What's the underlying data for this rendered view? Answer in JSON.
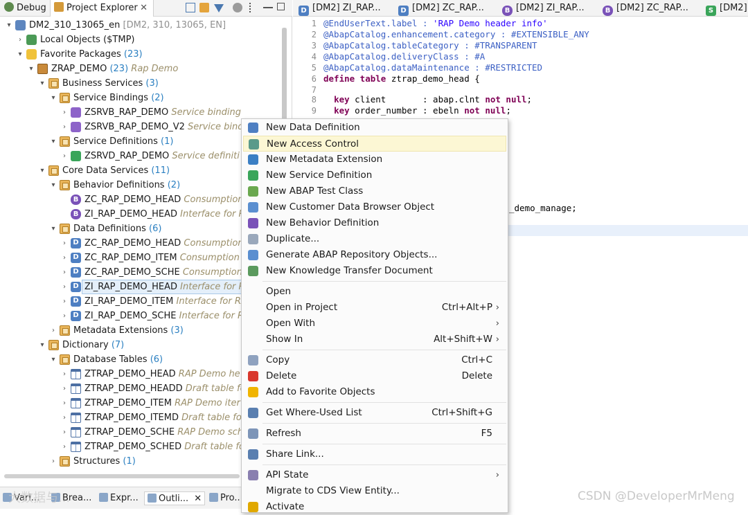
{
  "left_tabs": {
    "debug": "Debug",
    "project_explorer": "Project Explorer",
    "close": "✕"
  },
  "tree": [
    {
      "indent": 0,
      "twisty": "▾",
      "icon": "proj",
      "label": "DM2_310_13065_en",
      "count": "",
      "desc": "[DM2, 310, 13065, EN]",
      "desc_plain": true
    },
    {
      "indent": 1,
      "twisty": "›",
      "icon": "local",
      "label": "Local Objects ($TMP)",
      "count": "",
      "desc": ""
    },
    {
      "indent": 1,
      "twisty": "▾",
      "icon": "fav",
      "label": "Favorite Packages",
      "count": "(23)",
      "desc": ""
    },
    {
      "indent": 2,
      "twisty": "▾",
      "icon": "pkg",
      "label": "ZRAP_DEMO",
      "count": "(23)",
      "desc": "Rap Demo"
    },
    {
      "indent": 3,
      "twisty": "▾",
      "icon": "pkgfolder",
      "label": "Business Services",
      "count": "(3)",
      "desc": ""
    },
    {
      "indent": 4,
      "twisty": "▾",
      "icon": "pkgfolder",
      "label": "Service Bindings",
      "count": "(2)",
      "desc": ""
    },
    {
      "indent": 5,
      "twisty": "›",
      "icon": "bind",
      "label": "ZSRVB_RAP_DEMO",
      "count": "",
      "desc": "Service binding"
    },
    {
      "indent": 5,
      "twisty": "›",
      "icon": "bind",
      "label": "ZSRVB_RAP_DEMO_V2",
      "count": "",
      "desc": "Service bindi"
    },
    {
      "indent": 4,
      "twisty": "▾",
      "icon": "pkgfolder",
      "label": "Service Definitions",
      "count": "(1)",
      "desc": ""
    },
    {
      "indent": 5,
      "twisty": "›",
      "icon": "sd",
      "label": "ZSRVD_RAP_DEMO",
      "count": "",
      "desc": "Service definiti"
    },
    {
      "indent": 3,
      "twisty": "▾",
      "icon": "pkgfolder",
      "label": "Core Data Services",
      "count": "(11)",
      "desc": ""
    },
    {
      "indent": 4,
      "twisty": "▾",
      "icon": "pkgfolder",
      "label": "Behavior Definitions",
      "count": "(2)",
      "desc": ""
    },
    {
      "indent": 5,
      "twisty": "",
      "icon": "b",
      "label": "ZC_RAP_DEMO_HEAD",
      "count": "",
      "desc": "Consumption"
    },
    {
      "indent": 5,
      "twisty": "",
      "icon": "b",
      "label": "ZI_RAP_DEMO_HEAD",
      "count": "",
      "desc": "Interface for R"
    },
    {
      "indent": 4,
      "twisty": "▾",
      "icon": "pkgfolder",
      "label": "Data Definitions",
      "count": "(6)",
      "desc": ""
    },
    {
      "indent": 5,
      "twisty": "›",
      "icon": "d",
      "label": "ZC_RAP_DEMO_HEAD",
      "count": "",
      "desc": "Consumption"
    },
    {
      "indent": 5,
      "twisty": "›",
      "icon": "d",
      "label": "ZC_RAP_DEMO_ITEM",
      "count": "",
      "desc": "Consumption"
    },
    {
      "indent": 5,
      "twisty": "›",
      "icon": "d",
      "label": "ZC_RAP_DEMO_SCHE",
      "count": "",
      "desc": "Consumption"
    },
    {
      "indent": 5,
      "twisty": "›",
      "icon": "d",
      "label": "ZI_RAP_DEMO_HEAD",
      "count": "",
      "desc": "Interface for R",
      "selected": true
    },
    {
      "indent": 5,
      "twisty": "›",
      "icon": "d",
      "label": "ZI_RAP_DEMO_ITEM",
      "count": "",
      "desc": "Interface for RA"
    },
    {
      "indent": 5,
      "twisty": "›",
      "icon": "d",
      "label": "ZI_RAP_DEMO_SCHE",
      "count": "",
      "desc": "Interface for R"
    },
    {
      "indent": 4,
      "twisty": "›",
      "icon": "pkgfolder",
      "label": "Metadata Extensions",
      "count": "(3)",
      "desc": ""
    },
    {
      "indent": 3,
      "twisty": "▾",
      "icon": "pkgfolder",
      "label": "Dictionary",
      "count": "(7)",
      "desc": ""
    },
    {
      "indent": 4,
      "twisty": "▾",
      "icon": "pkgfolder",
      "label": "Database Tables",
      "count": "(6)",
      "desc": ""
    },
    {
      "indent": 5,
      "twisty": "›",
      "icon": "table",
      "label": "ZTRAP_DEMO_HEAD",
      "count": "",
      "desc": "RAP Demo he"
    },
    {
      "indent": 5,
      "twisty": "›",
      "icon": "table",
      "label": "ZTRAP_DEMO_HEADD",
      "count": "",
      "desc": "Draft table fo"
    },
    {
      "indent": 5,
      "twisty": "›",
      "icon": "table",
      "label": "ZTRAP_DEMO_ITEM",
      "count": "",
      "desc": "RAP Demo iter"
    },
    {
      "indent": 5,
      "twisty": "›",
      "icon": "table",
      "label": "ZTRAP_DEMO_ITEMD",
      "count": "",
      "desc": "Draft table fo"
    },
    {
      "indent": 5,
      "twisty": "›",
      "icon": "table",
      "label": "ZTRAP_DEMO_SCHE",
      "count": "",
      "desc": "RAP Demo sch"
    },
    {
      "indent": 5,
      "twisty": "›",
      "icon": "table",
      "label": "ZTRAP_DEMO_SCHED",
      "count": "",
      "desc": "Draft table fo"
    },
    {
      "indent": 4,
      "twisty": "›",
      "icon": "pkgfolder",
      "label": "Structures",
      "count": "(1)",
      "desc": ""
    }
  ],
  "bottom_tabs": [
    "Vari...",
    "Brea...",
    "Expr...",
    "Outli...",
    "Pro..."
  ],
  "bottom_close": "✕",
  "editor_tabs": [
    {
      "label": "[DM2] ZI_RAP...",
      "icon": "D",
      "color": "#4e7fc2"
    },
    {
      "label": "[DM2] ZC_RAP...",
      "icon": "D",
      "color": "#4e7fc2"
    },
    {
      "label": "[DM2] ZI_RAP...",
      "icon": "B",
      "color": "#7a52b8"
    },
    {
      "label": "[DM2] ZC_RAP...",
      "icon": "B",
      "color": "#7a52b8"
    },
    {
      "label": "[DM2]",
      "icon": "S",
      "color": "#3aa55a"
    }
  ],
  "code": [
    {
      "n": "1",
      "parts": [
        [
          "ann",
          "@EndUserText.label : "
        ],
        [
          "str",
          "'RAP Demo header info'"
        ]
      ]
    },
    {
      "n": "2",
      "parts": [
        [
          "ann",
          "@AbapCatalog.enhancement.category : #EXTENSIBLE_ANY"
        ]
      ]
    },
    {
      "n": "3",
      "parts": [
        [
          "ann",
          "@AbapCatalog.tableCategory : #TRANSPARENT"
        ]
      ]
    },
    {
      "n": "4",
      "parts": [
        [
          "ann",
          "@AbapCatalog.deliveryClass : #A"
        ]
      ]
    },
    {
      "n": "5",
      "parts": [
        [
          "ann",
          "@AbapCatalog.dataMaintenance : #RESTRICTED"
        ]
      ]
    },
    {
      "n": "6",
      "parts": [
        [
          "kw",
          "define table"
        ],
        [
          "plain",
          " ztrap_demo_head {"
        ]
      ]
    },
    {
      "n": "7",
      "parts": []
    },
    {
      "n": "8",
      "parts": [
        [
          "plain",
          "  "
        ],
        [
          "kw",
          "key"
        ],
        [
          "plain",
          " client       : abap.clnt "
        ],
        [
          "kw",
          "not null"
        ],
        [
          "plain",
          ";"
        ]
      ]
    },
    {
      "n": "9",
      "parts": [
        [
          "plain",
          "  "
        ],
        [
          "kw",
          "key"
        ],
        [
          "plain",
          " order_number : ebeln "
        ],
        [
          "kw",
          "not null"
        ],
        [
          "plain",
          ";"
        ]
      ]
    }
  ],
  "code_fragment": "_demo_manage;",
  "menu": {
    "items": [
      {
        "type": "item",
        "label": "New Data Definition",
        "icon": "#4e7fc2",
        "iconname": "data-definition-icon"
      },
      {
        "type": "item",
        "label": "New Access Control",
        "icon": "#5a9a8a",
        "iconname": "access-control-icon",
        "hover": true
      },
      {
        "type": "item",
        "label": "New Metadata Extension",
        "icon": "#3b7fc4",
        "iconname": "metadata-extension-icon"
      },
      {
        "type": "item",
        "label": "New Service Definition",
        "icon": "#3aa55a",
        "iconname": "service-definition-icon"
      },
      {
        "type": "item",
        "label": "New ABAP Test Class",
        "icon": "#6aa84f",
        "iconname": "test-class-icon"
      },
      {
        "type": "item",
        "label": "New Customer Data Browser Object",
        "icon": "#5b8fd0",
        "iconname": "data-browser-icon"
      },
      {
        "type": "item",
        "label": "New Behavior Definition",
        "icon": "#7a52b8",
        "iconname": "behavior-definition-icon"
      },
      {
        "type": "item",
        "label": "Duplicate...",
        "icon": "#9aa8bb",
        "iconname": "duplicate-icon"
      },
      {
        "type": "item",
        "label": "Generate ABAP Repository Objects...",
        "icon": "#5b8fd0",
        "iconname": "generate-icon"
      },
      {
        "type": "item",
        "label": "New Knowledge Transfer Document",
        "icon": "#5b9a5e",
        "iconname": "knowledge-transfer-icon"
      },
      {
        "type": "sep"
      },
      {
        "type": "item",
        "label": "Open",
        "icon": "",
        "iconname": ""
      },
      {
        "type": "item",
        "label": "Open in Project",
        "shortcut": "Ctrl+Alt+P",
        "arrow": true
      },
      {
        "type": "item",
        "label": "Open With",
        "arrow": true
      },
      {
        "type": "item",
        "label": "Show In",
        "shortcut": "Alt+Shift+W",
        "arrow": true
      },
      {
        "type": "sep"
      },
      {
        "type": "item",
        "label": "Copy",
        "shortcut": "Ctrl+C",
        "icon": "#8fa2bf",
        "iconname": "copy-icon"
      },
      {
        "type": "item",
        "label": "Delete",
        "shortcut": "Delete",
        "icon": "#d9382e",
        "iconname": "delete-icon"
      },
      {
        "type": "item",
        "label": "Add to Favorite Objects",
        "icon": "#f0b400",
        "iconname": "star-icon"
      },
      {
        "type": "sep"
      },
      {
        "type": "item",
        "label": "Get Where-Used List",
        "shortcut": "Ctrl+Shift+G",
        "icon": "#5a7fb0",
        "iconname": "where-used-icon"
      },
      {
        "type": "sep"
      },
      {
        "type": "item",
        "label": "Refresh",
        "shortcut": "F5",
        "icon": "#7d95b8",
        "iconname": "refresh-icon"
      },
      {
        "type": "sep"
      },
      {
        "type": "item",
        "label": "Share Link...",
        "icon": "#5a7fb0",
        "iconname": "share-link-icon"
      },
      {
        "type": "sep"
      },
      {
        "type": "item",
        "label": "API State",
        "arrow": true,
        "icon": "#8a7fb0",
        "iconname": "api-state-icon"
      },
      {
        "type": "item",
        "label": "Migrate to CDS View Entity...",
        "icon": "",
        "iconname": ""
      },
      {
        "type": "item",
        "label": "Activate",
        "icon": "#e0a800",
        "iconname": "activate-icon"
      }
    ]
  },
  "watermark": "CSDN @DeveloperMrMeng",
  "watermark2": "大数据与..."
}
